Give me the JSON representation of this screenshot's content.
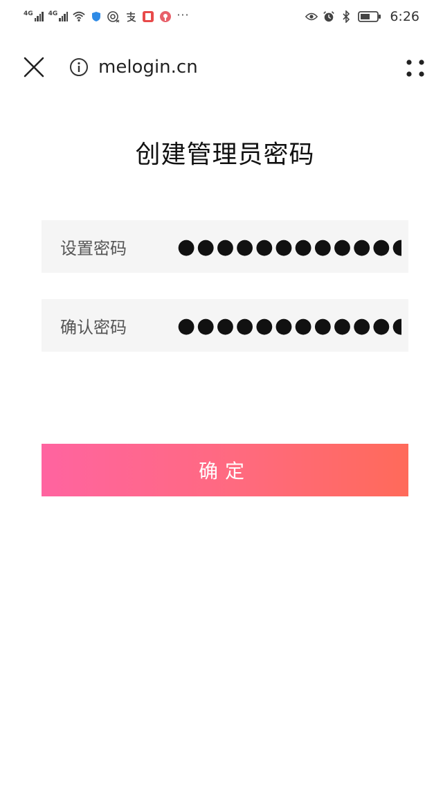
{
  "status_bar": {
    "network_1": "4G",
    "network_2": "4G",
    "more": "···",
    "time": "6:26"
  },
  "toolbar": {
    "url": "melogin.cn"
  },
  "form": {
    "title": "创建管理员密码",
    "set_password_label": "设置密码",
    "set_password_value": "●●●●●●●●●●●●",
    "confirm_password_label": "确认密码",
    "confirm_password_value": "●●●●●●●●●●●●",
    "submit_label": "确定"
  },
  "colors": {
    "button_gradient_start": "#ff64a0",
    "button_gradient_end": "#ff6a5a",
    "field_background": "#f5f5f5"
  }
}
